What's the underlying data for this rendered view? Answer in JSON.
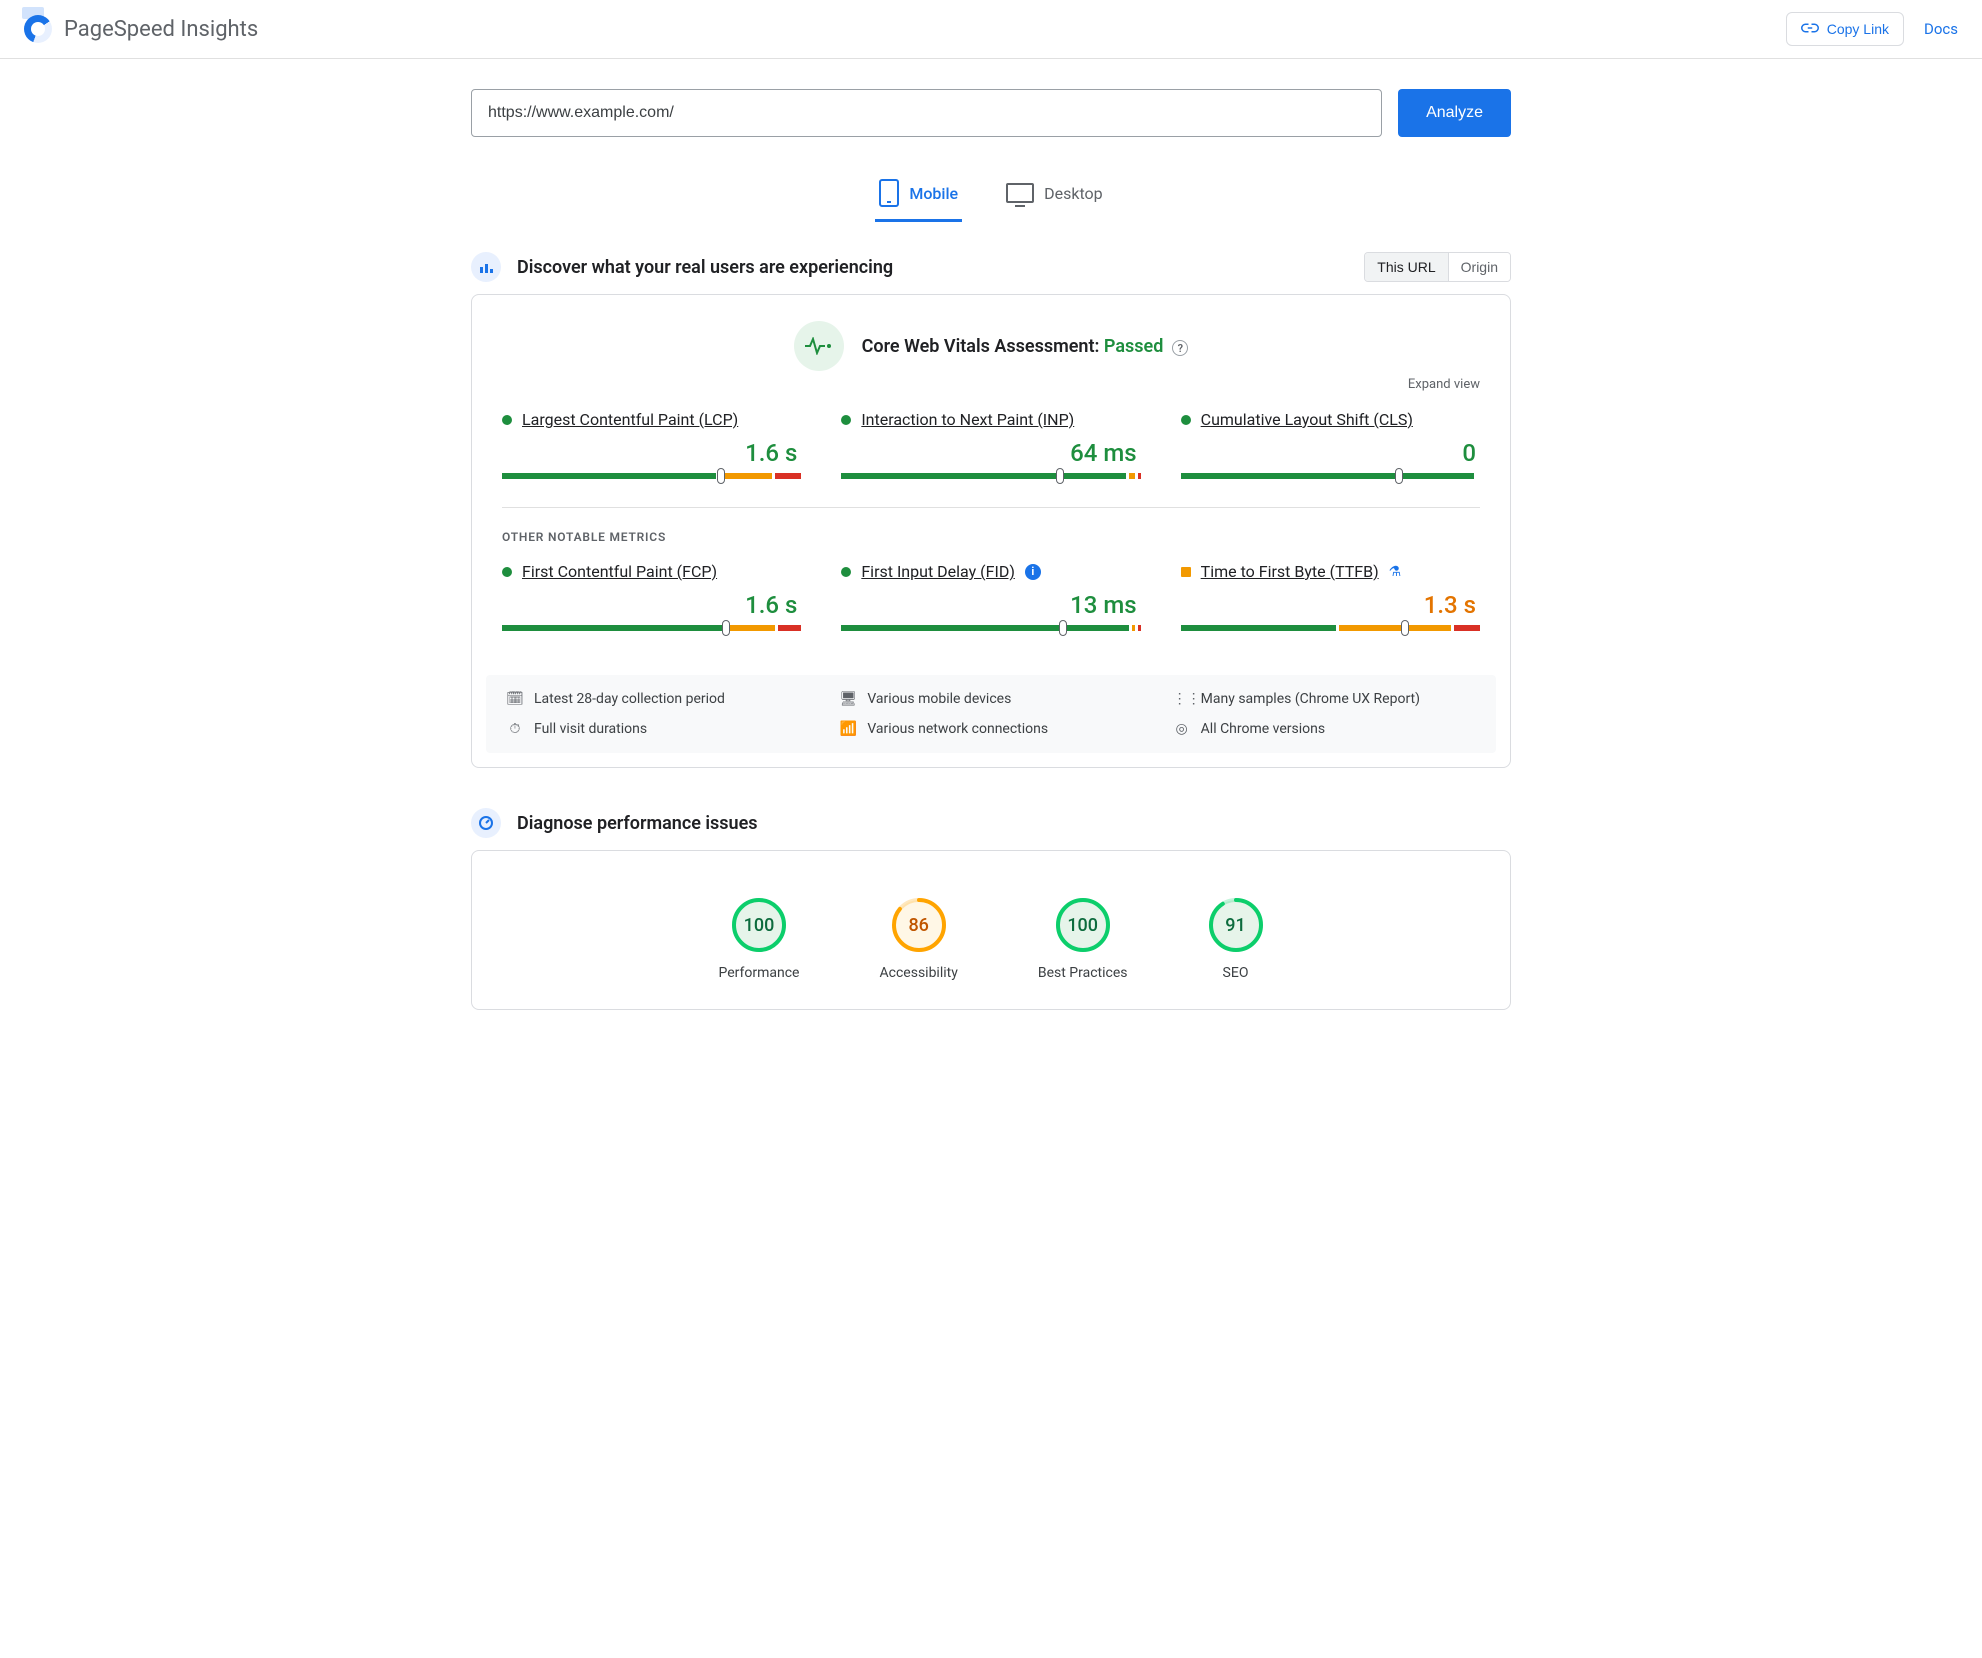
{
  "app": {
    "title": "PageSpeed Insights"
  },
  "header": {
    "copy_link": "Copy Link",
    "docs": "Docs"
  },
  "url_input": {
    "value": "https://www.example.com/"
  },
  "analyze_label": "Analyze",
  "tabs": {
    "mobile": "Mobile",
    "desktop": "Desktop"
  },
  "discover": {
    "title": "Discover what your real users are experiencing",
    "toggle_this_url": "This URL",
    "toggle_origin": "Origin"
  },
  "assessment": {
    "label": "Core Web Vitals Assessment:",
    "status": "Passed",
    "expand": "Expand view"
  },
  "metrics_primary": [
    {
      "name": "Largest Contentful Paint (LCP)",
      "value": "1.6 s",
      "status": "green",
      "dist": [
        73,
        18,
        9
      ],
      "marker": 73
    },
    {
      "name": "Interaction to Next Paint (INP)",
      "value": "64 ms",
      "status": "green",
      "dist": [
        97,
        2,
        1
      ],
      "marker": 73
    },
    {
      "name": "Cumulative Layout Shift (CLS)",
      "value": "0",
      "status": "green",
      "dist": [
        100,
        0,
        0
      ],
      "marker": 73
    }
  ],
  "other_label": "OTHER NOTABLE METRICS",
  "metrics_other": [
    {
      "name": "First Contentful Paint (FCP)",
      "value": "1.6 s",
      "status": "green",
      "dist": [
        76,
        16,
        8
      ],
      "marker": 75,
      "icon": null
    },
    {
      "name": "First Input Delay (FID)",
      "value": "13 ms",
      "status": "green",
      "dist": [
        98,
        1,
        1
      ],
      "marker": 74,
      "icon": "info"
    },
    {
      "name": "Time to First Byte (TTFB)",
      "value": "1.3 s",
      "status": "orange",
      "dist": [
        53,
        38,
        9
      ],
      "marker": 75,
      "icon": "flask"
    }
  ],
  "footnotes": {
    "period": "Latest 28-day collection period",
    "devices": "Various mobile devices",
    "samples_prefix": "Many samples (",
    "samples_link": "Chrome UX Report",
    "samples_suffix": ")",
    "visits": "Full visit durations",
    "network": "Various network connections",
    "chrome": "All Chrome versions"
  },
  "diagnose": {
    "title": "Diagnose performance issues"
  },
  "gauges": [
    {
      "label": "Performance",
      "value": 100,
      "color": "green"
    },
    {
      "label": "Accessibility",
      "value": 86,
      "color": "orange"
    },
    {
      "label": "Best Practices",
      "value": 100,
      "color": "green"
    },
    {
      "label": "SEO",
      "value": 91,
      "color": "green"
    }
  ],
  "chart_data": {
    "type": "table",
    "title": "PageSpeed Insights — Mobile field data",
    "core_web_vitals_passed": true,
    "metrics": [
      {
        "name": "Largest Contentful Paint (LCP)",
        "value": 1.6,
        "unit": "s",
        "status": "good",
        "distribution_pct": {
          "good": 73,
          "needs_improvement": 18,
          "poor": 9
        }
      },
      {
        "name": "Interaction to Next Paint (INP)",
        "value": 64,
        "unit": "ms",
        "status": "good",
        "distribution_pct": {
          "good": 97,
          "needs_improvement": 2,
          "poor": 1
        }
      },
      {
        "name": "Cumulative Layout Shift (CLS)",
        "value": 0,
        "unit": "",
        "status": "good",
        "distribution_pct": {
          "good": 100,
          "needs_improvement": 0,
          "poor": 0
        }
      },
      {
        "name": "First Contentful Paint (FCP)",
        "value": 1.6,
        "unit": "s",
        "status": "good",
        "distribution_pct": {
          "good": 76,
          "needs_improvement": 16,
          "poor": 8
        }
      },
      {
        "name": "First Input Delay (FID)",
        "value": 13,
        "unit": "ms",
        "status": "good",
        "distribution_pct": {
          "good": 98,
          "needs_improvement": 1,
          "poor": 1
        }
      },
      {
        "name": "Time to First Byte (TTFB)",
        "value": 1.3,
        "unit": "s",
        "status": "needs_improvement",
        "distribution_pct": {
          "good": 53,
          "needs_improvement": 38,
          "poor": 9
        }
      }
    ],
    "lighthouse_scores": {
      "Performance": 100,
      "Accessibility": 86,
      "Best Practices": 100,
      "SEO": 91
    }
  }
}
